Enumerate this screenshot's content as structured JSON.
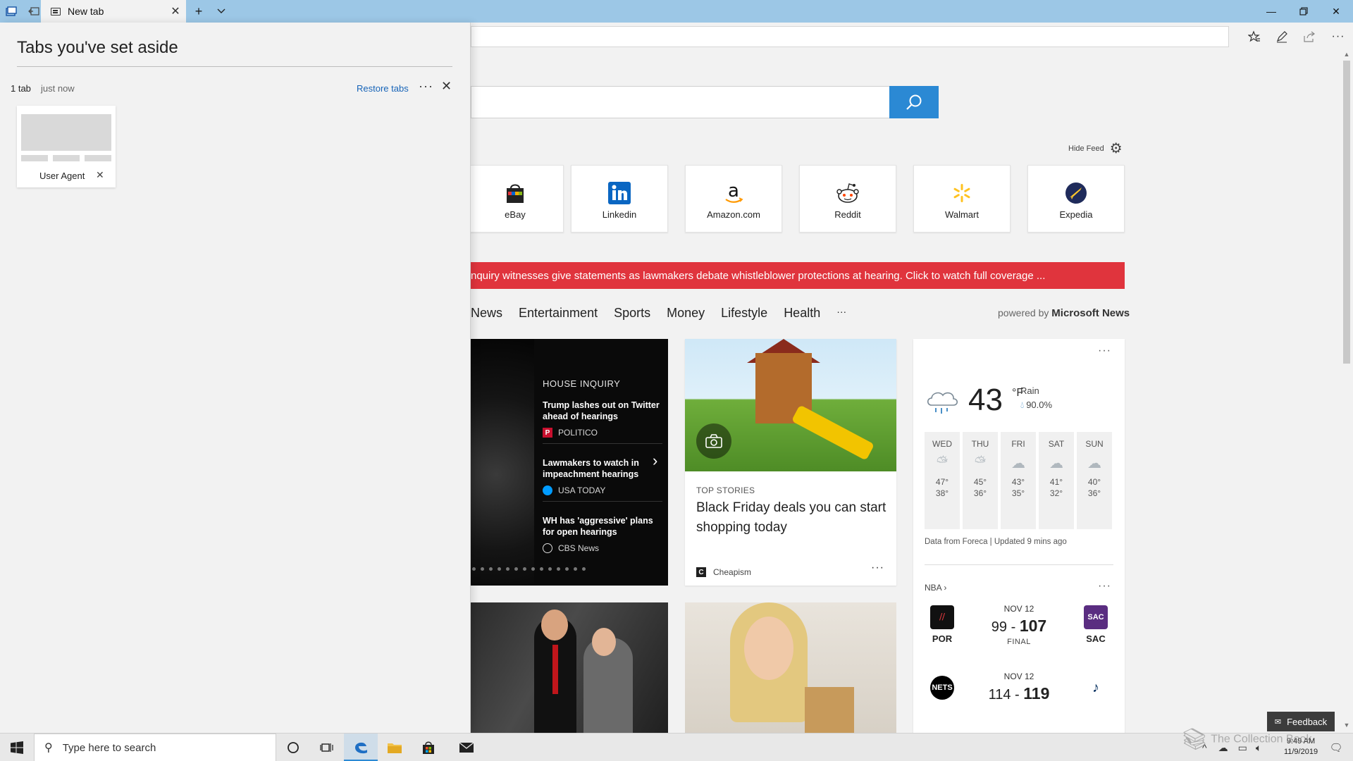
{
  "browser": {
    "tab_title": "New tab",
    "new_tab_icon": "+",
    "tab_list_icon": "chevron-down-icon"
  },
  "set_aside": {
    "title": "Tabs you've set aside",
    "count": "1 tab",
    "when": "just now",
    "restore_label": "Restore tabs",
    "tabs": [
      {
        "name": "User Agent"
      }
    ]
  },
  "page": {
    "hide_feed_label": "Hide Feed",
    "top_sites": [
      {
        "name": "eBay",
        "icon": "ebay-bag-icon"
      },
      {
        "name": "Linkedin",
        "icon": "linkedin-icon"
      },
      {
        "name": "Amazon.com",
        "icon": "amazon-icon"
      },
      {
        "name": "Reddit",
        "icon": "reddit-icon"
      },
      {
        "name": "Walmart",
        "icon": "walmart-icon"
      },
      {
        "name": "Expedia",
        "icon": "expedia-icon"
      }
    ],
    "breaking_news": "nquiry witnesses give statements as lawmakers debate whistleblower protections at hearing. Click to watch full coverage ...",
    "categories": [
      "News",
      "Entertainment",
      "Sports",
      "Money",
      "Lifestyle",
      "Health",
      "···"
    ],
    "powered_by_prefix": "powered by",
    "powered_by_brand": "Microsoft News",
    "hero": {
      "kicker": "HOUSE INQUIRY",
      "items": [
        {
          "headline": "Trump lashes out on Twitter ahead of hearings",
          "source": "POLITICO"
        },
        {
          "headline": "Lawmakers to watch in impeachment hearings",
          "source": "USA TODAY"
        },
        {
          "headline": "WH has 'aggressive' plans for open hearings",
          "source": "CBS News"
        }
      ]
    },
    "story": {
      "category": "TOP STORIES",
      "title": "Black Friday deals you can start shopping today",
      "source": "Cheapism"
    },
    "weather": {
      "temp": "43",
      "unit": "°F",
      "condition": "Rain",
      "precip": "90.0%",
      "days": [
        {
          "name": "WED",
          "hi": "47°",
          "lo": "38°",
          "icon": "partly-sunny-icon"
        },
        {
          "name": "THU",
          "hi": "45°",
          "lo": "36°",
          "icon": "partly-sunny-icon"
        },
        {
          "name": "FRI",
          "hi": "43°",
          "lo": "35°",
          "icon": "cloud-icon"
        },
        {
          "name": "SAT",
          "hi": "41°",
          "lo": "32°",
          "icon": "cloud-icon"
        },
        {
          "name": "SUN",
          "hi": "40°",
          "lo": "36°",
          "icon": "cloud-icon"
        }
      ],
      "footer": "Data from Foreca | Updated 9 mins ago"
    },
    "nba": {
      "label": "NBA",
      "games": [
        {
          "date": "NOV 12",
          "away": "POR",
          "home": "SAC",
          "away_score": "99",
          "home_score": "107",
          "status": "FINAL"
        },
        {
          "date": "NOV 12",
          "away": "BKN",
          "home": "UTA",
          "away_score": "114",
          "home_score": "119",
          "status": ""
        }
      ]
    },
    "feedback_label": "Feedback"
  },
  "taskbar": {
    "search_placeholder": "Type here to search",
    "time": "9:49 AM",
    "date": "11/9/2019",
    "watermark": "The Collection Book"
  },
  "colors": {
    "accent": "#2b89d4",
    "titlebar": "#9cc7e6",
    "breaking": "#e0343d"
  }
}
